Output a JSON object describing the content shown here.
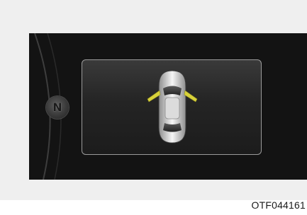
{
  "cluster": {
    "gear_indicator": {
      "label": "N"
    },
    "door_status": {
      "icon": "car-top-view-icon",
      "open_doors": [
        "front-left",
        "front-right"
      ],
      "alert_color": "#d8d23a"
    }
  },
  "figure": {
    "code": "OTF044161"
  },
  "colors": {
    "background": "#efefef",
    "cluster_bg": "#131313",
    "panel_border": "#9b9b9b"
  }
}
